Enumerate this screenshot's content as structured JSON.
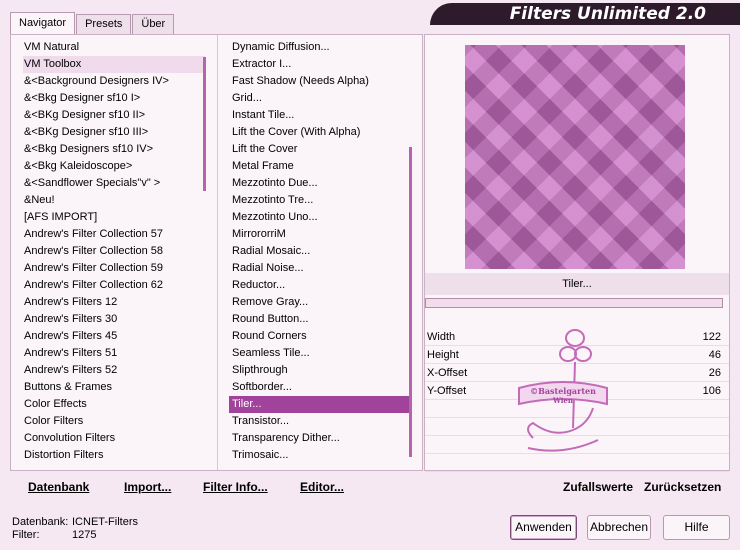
{
  "app": {
    "brand": "Filters Unlimited 2.0"
  },
  "tabs": [
    "Navigator",
    "Presets",
    "Über"
  ],
  "categories": [
    "VM Natural",
    "VM Toolbox",
    "&<Background Designers IV>",
    "&<Bkg Designer sf10 I>",
    "&<BKg Designer sf10 II>",
    "&<BKg Designer sf10 III>",
    "&<Bkg Designers sf10 IV>",
    "&<Bkg Kaleidoscope>",
    "&<Sandflower Specials\"v\" >",
    "&Neu!",
    "[AFS IMPORT]",
    "Andrew's Filter Collection 57",
    "Andrew's Filter Collection 58",
    "Andrew's Filter Collection 59",
    "Andrew's Filter Collection 62",
    "Andrew's Filters 12",
    "Andrew's Filters 30",
    "Andrew's Filters 45",
    "Andrew's Filters 51",
    "Andrew's Filters 52",
    "Buttons & Frames",
    "Color Effects",
    "Color Filters",
    "Convolution Filters",
    "Distortion Filters"
  ],
  "filters": [
    "Dynamic Diffusion...",
    "Extractor I...",
    "Fast Shadow (Needs Alpha)",
    "Grid...",
    "Instant Tile...",
    "Lift the Cover (With Alpha)",
    "Lift the Cover",
    "Metal Frame",
    "Mezzotinto Due...",
    "Mezzotinto Tre...",
    "Mezzotinto Uno...",
    "MirrororriM",
    "Radial Mosaic...",
    "Radial Noise...",
    "Reductor...",
    "Remove Gray...",
    "Round Button...",
    "Round Corners",
    "Seamless Tile...",
    "Slipthrough",
    "Softborder...",
    "Tiler...",
    "Transistor...",
    "Transparency Dither...",
    "Trimosaic..."
  ],
  "selected_category": "VM Toolbox",
  "selected_filter": "Tiler...",
  "preview": {
    "filter_name": "Tiler...",
    "color": "#c86fc2"
  },
  "params": [
    {
      "label": "Width",
      "value": "122"
    },
    {
      "label": "Height",
      "value": "46"
    },
    {
      "label": "X-Offset",
      "value": "26"
    },
    {
      "label": "Y-Offset",
      "value": "106"
    }
  ],
  "watermark": {
    "line1": "©Bastelgarten",
    "line2": "Wien"
  },
  "footer": {
    "datenbank": "Datenbank",
    "import": "Import...",
    "filter_info": "Filter Info...",
    "editor": "Editor...",
    "zufall": "Zufallswerte",
    "reset": "Zurücksetzen"
  },
  "status": {
    "db_label": "Datenbank:",
    "db_value": "ICNET-Filters",
    "filter_label": "Filter:",
    "filter_value": "1275"
  },
  "buttons": {
    "apply": "Anwenden",
    "cancel": "Abbrechen",
    "help": "Hilfe"
  }
}
